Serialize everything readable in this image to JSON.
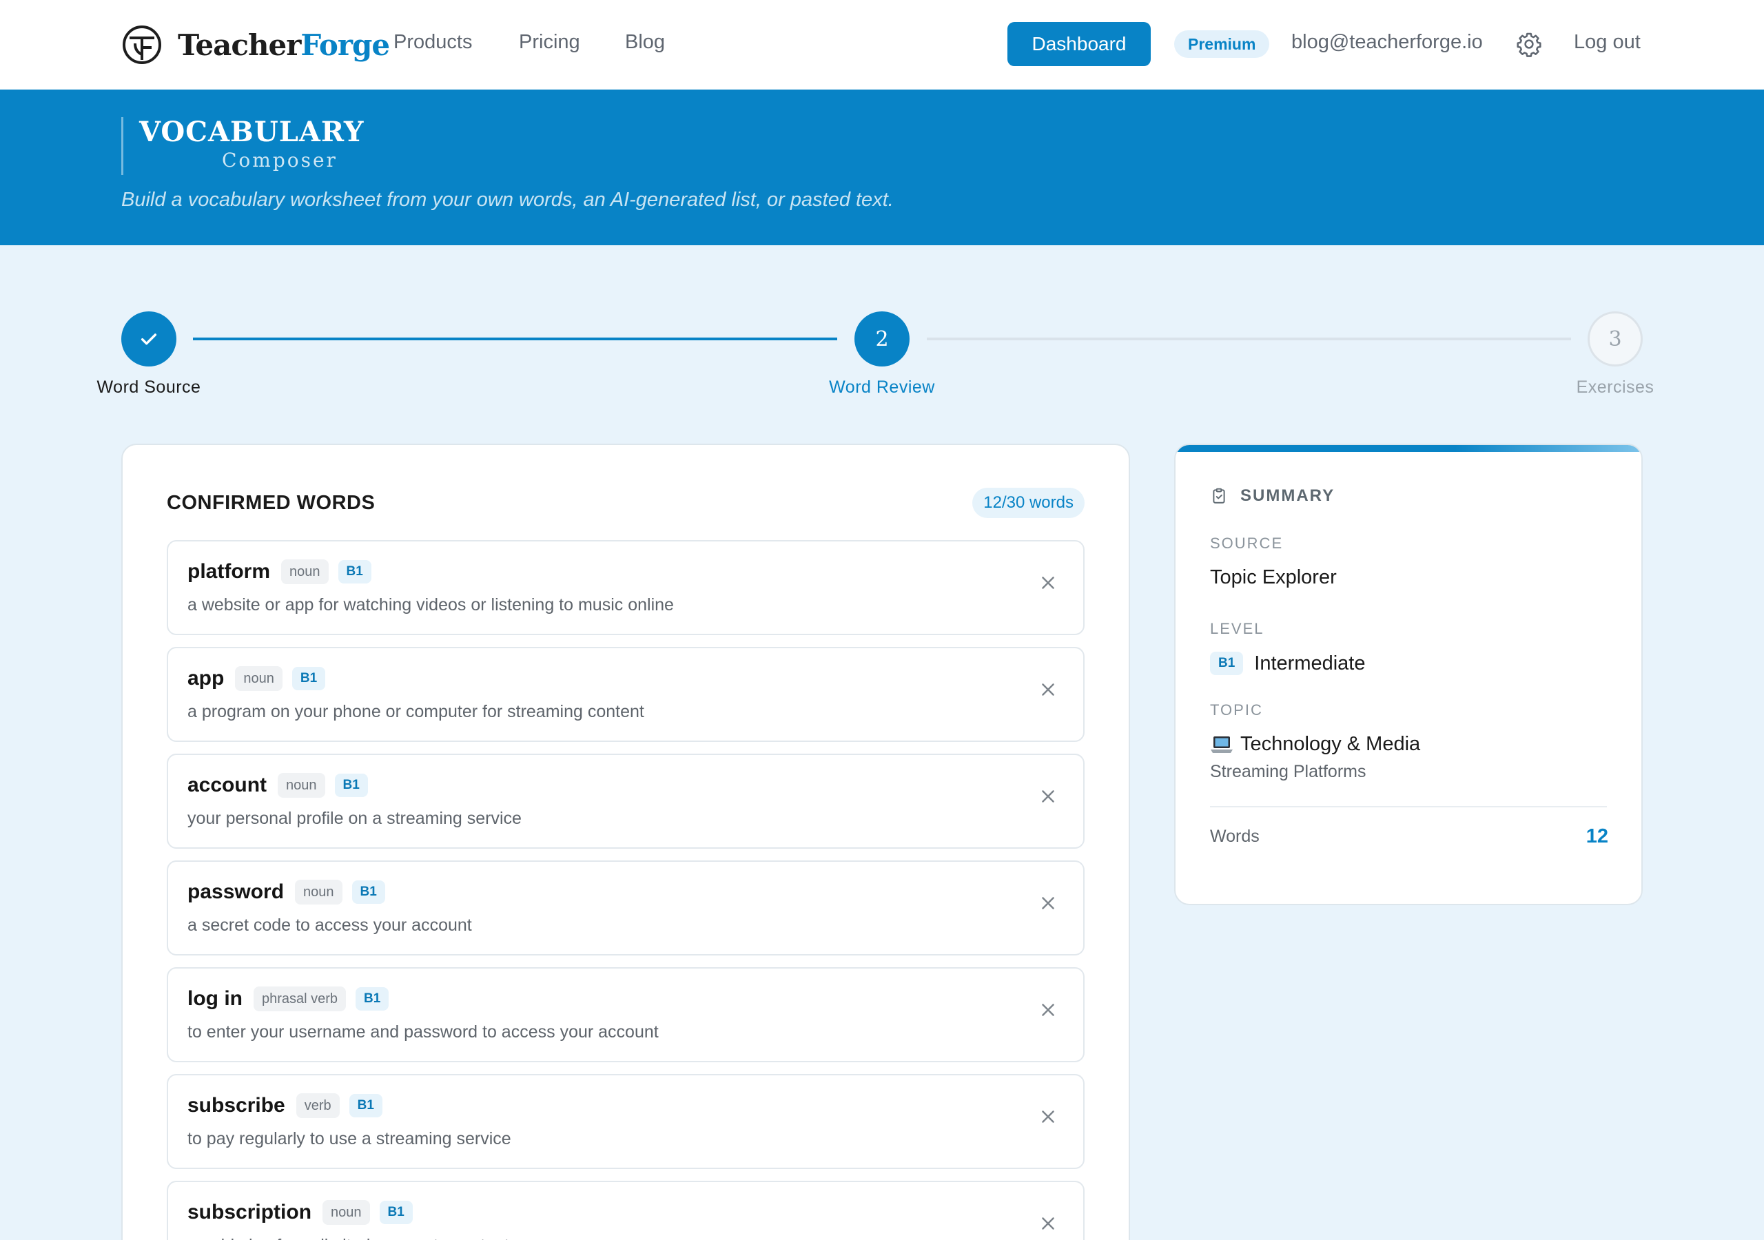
{
  "nav": {
    "brand_part1": "Teacher",
    "brand_part2": "Forge",
    "links": [
      "Products",
      "Pricing",
      "Blog"
    ],
    "dashboard_label": "Dashboard",
    "premium_label": "Premium",
    "email": "blog@teacherforge.io",
    "logout_label": "Log out"
  },
  "hero": {
    "title": "VOCABULARY",
    "subtitle": "Composer",
    "description": "Build a vocabulary worksheet from your own words, an AI-generated list, or pasted text."
  },
  "stepper": {
    "steps": [
      {
        "label": "Word Source",
        "number": "1",
        "state": "done"
      },
      {
        "label": "Word Review",
        "number": "2",
        "state": "active"
      },
      {
        "label": "Exercises",
        "number": "3",
        "state": "todo"
      }
    ]
  },
  "words": {
    "title": "CONFIRMED WORDS",
    "count_label": "12/30 words",
    "items": [
      {
        "word": "platform",
        "pos": "noun",
        "level": "B1",
        "definition": "a website or app for watching videos or listening to music online"
      },
      {
        "word": "app",
        "pos": "noun",
        "level": "B1",
        "definition": "a program on your phone or computer for streaming content"
      },
      {
        "word": "account",
        "pos": "noun",
        "level": "B1",
        "definition": "your personal profile on a streaming service"
      },
      {
        "word": "password",
        "pos": "noun",
        "level": "B1",
        "definition": "a secret code to access your account"
      },
      {
        "word": "log in",
        "pos": "phrasal verb",
        "level": "B1",
        "definition": "to enter your username and password to access your account"
      },
      {
        "word": "subscribe",
        "pos": "verb",
        "level": "B1",
        "definition": "to pay regularly to use a streaming service"
      },
      {
        "word": "subscription",
        "pos": "noun",
        "level": "B1",
        "definition": "a paid plan for unlimited access to content"
      }
    ]
  },
  "summary": {
    "title": "SUMMARY",
    "source_label": "SOURCE",
    "source_value": "Topic Explorer",
    "level_label": "LEVEL",
    "level_badge": "B1",
    "level_value": "Intermediate",
    "topic_label": "TOPIC",
    "topic_icon": "laptop-icon",
    "topic_value": "Technology & Media",
    "topic_sub": "Streaming Platforms",
    "words_label": "Words",
    "words_value": "12"
  },
  "colors": {
    "accent": "#0883c6",
    "background": "#e8f3fb"
  }
}
